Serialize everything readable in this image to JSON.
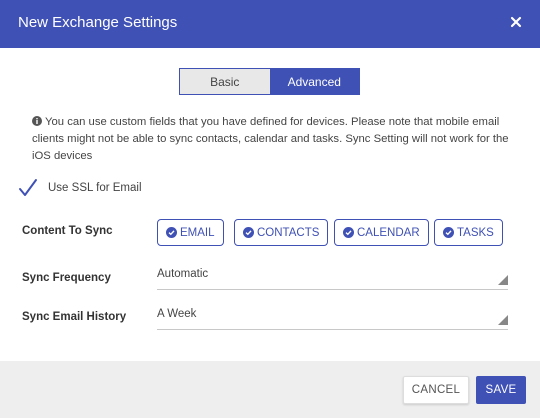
{
  "dialog": {
    "title": "New Exchange Settings",
    "close_icon": "close-icon"
  },
  "tabs": [
    {
      "label": "Basic",
      "selected": false
    },
    {
      "label": "Advanced",
      "selected": true
    }
  ],
  "info": {
    "icon": "info-icon",
    "text": "You can use custom fields that you have defined for devices. Please note that mobile email clients might not be able to sync contacts, calendar and tasks. Sync Setting will not work for the iOS devices"
  },
  "ssl": {
    "label": "Use SSL for Email",
    "checked": true
  },
  "content_to_sync": {
    "label": "Content To Sync",
    "options": [
      {
        "label": "EMAIL",
        "checked": true
      },
      {
        "label": "CONTACTS",
        "checked": true
      },
      {
        "label": "CALENDAR",
        "checked": true
      },
      {
        "label": "TASKS",
        "checked": true
      }
    ]
  },
  "sync_frequency": {
    "label": "Sync Frequency",
    "value": "Automatic"
  },
  "sync_email_history": {
    "label": "Sync Email History",
    "value": "A Week"
  },
  "footer": {
    "cancel_label": "CANCEL",
    "save_label": "SAVE"
  },
  "colors": {
    "primary": "#3f51b5",
    "footer_bg": "#eeeeee"
  }
}
